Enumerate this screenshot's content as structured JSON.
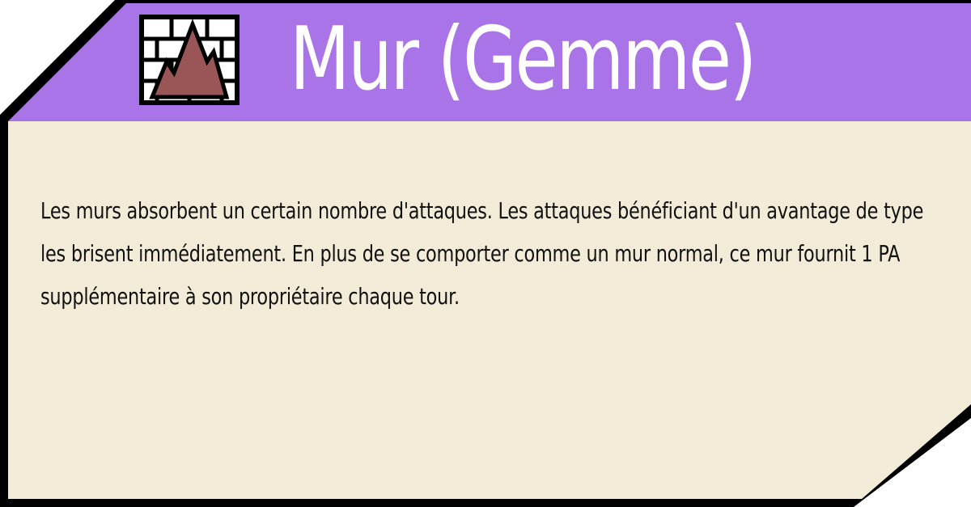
{
  "card": {
    "title": "Mur (Gemme)",
    "icon": "wall-gem-mountain-icon",
    "description": "Les murs absorbent un certain nombre d'attaques. Les attaques bénéficiant d'un avantage de type les brisent immédiatement. En plus de se comporter comme un mur normal, ce mur fournit 1 PA supplémentaire à son propriétaire chaque tour."
  },
  "colors": {
    "header": "#a974e8",
    "body": "#f2ebd7",
    "border": "#000000",
    "icon_mountain": "#9a5656",
    "title_text": "#ffffff",
    "body_text": "#111111"
  }
}
